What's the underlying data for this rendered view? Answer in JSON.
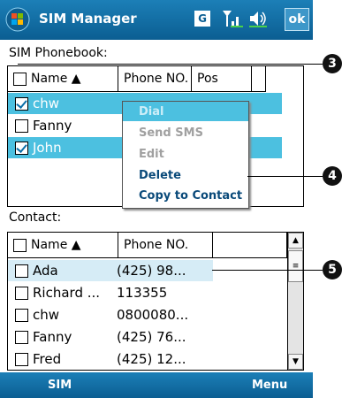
{
  "title_bar": {
    "app_title": "SIM Manager",
    "g_badge": "G",
    "ok_label": "ok"
  },
  "phonebook": {
    "section_label": "SIM Phonebook:",
    "columns": [
      "Name ▲",
      "Phone NO.",
      "Pos"
    ],
    "rows": [
      {
        "name": "chw",
        "checked": true,
        "selected": true
      },
      {
        "name": "Fanny",
        "checked": false,
        "selected": false
      },
      {
        "name": "John",
        "checked": true,
        "selected": true
      }
    ]
  },
  "context_menu": {
    "items": [
      {
        "label": "Dial",
        "enabled": false,
        "highlighted": true
      },
      {
        "label": "Send SMS",
        "enabled": false
      },
      {
        "label": "Edit",
        "enabled": false
      },
      {
        "label": "Delete",
        "enabled": true
      },
      {
        "label": "Copy to Contact",
        "enabled": true
      }
    ]
  },
  "contacts": {
    "section_label": "Contact:",
    "columns": [
      "Name ▲",
      "Phone NO."
    ],
    "rows": [
      {
        "name": "Ada",
        "phone": "(425) 98...",
        "selected": true
      },
      {
        "name": "Richard ...",
        "phone": "113355"
      },
      {
        "name": "chw",
        "phone": "0800080..."
      },
      {
        "name": "Fanny",
        "phone": "(425) 76..."
      },
      {
        "name": "Fred",
        "phone": "(425) 12..."
      }
    ]
  },
  "callouts": [
    "3",
    "4",
    "5"
  ],
  "bottom_bar": {
    "left_softkey": "SIM",
    "right_softkey": "Menu"
  },
  "colors": {
    "title_bar": "#1576ad",
    "selection": "#4cc0e0",
    "menu_highlight": "#4cc0e0",
    "disabled_text": "#a0a0a0"
  }
}
